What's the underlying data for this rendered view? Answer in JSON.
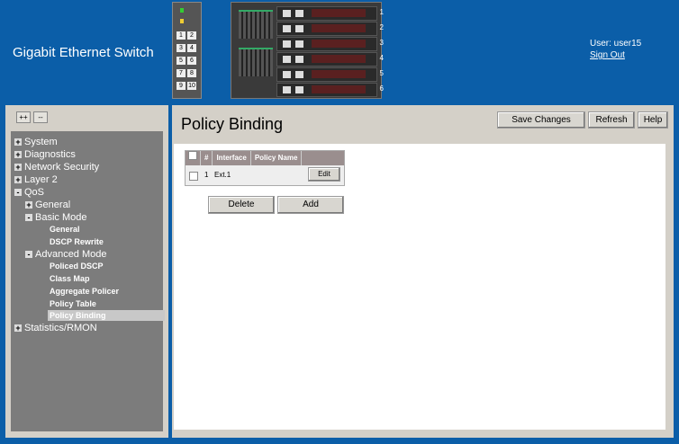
{
  "header": {
    "title": "Gigabit Ethernet Switch",
    "user_label": "User: user15",
    "sign_out": "Sign Out",
    "switch_ports": [
      "1",
      "2",
      "3",
      "4",
      "5",
      "6",
      "7",
      "8",
      "9",
      "10"
    ],
    "blade_numbers": [
      "1",
      "2",
      "3",
      "4",
      "5",
      "6"
    ]
  },
  "sidebar": {
    "expand_all": "++",
    "collapse_all": "--",
    "items": [
      {
        "label": "System",
        "state": "+"
      },
      {
        "label": "Diagnostics",
        "state": "+"
      },
      {
        "label": "Network Security",
        "state": "+"
      },
      {
        "label": "Layer 2",
        "state": "+"
      },
      {
        "label": "QoS",
        "state": "-"
      }
    ],
    "qos": {
      "general": "General",
      "basic_mode": "Basic Mode",
      "basic_general": "General",
      "dscp_rewrite": "DSCP Rewrite",
      "advanced_mode": "Advanced Mode",
      "policed_dscp": "Policed DSCP",
      "class_map": "Class Map",
      "aggregate_policer": "Aggregate Policer",
      "policy_table": "Policy Table",
      "policy_binding": "Policy Binding"
    },
    "statistics": "Statistics/RMON"
  },
  "main": {
    "title": "Policy Binding",
    "save_changes": "Save Changes",
    "refresh": "Refresh",
    "help": "Help",
    "table": {
      "columns": [
        "#",
        "Interface",
        "Policy Name"
      ],
      "rows": [
        {
          "num": "1",
          "interface": "Ext.1",
          "policy_name": "",
          "edit": "Edit"
        }
      ]
    },
    "delete": "Delete",
    "add": "Add"
  }
}
